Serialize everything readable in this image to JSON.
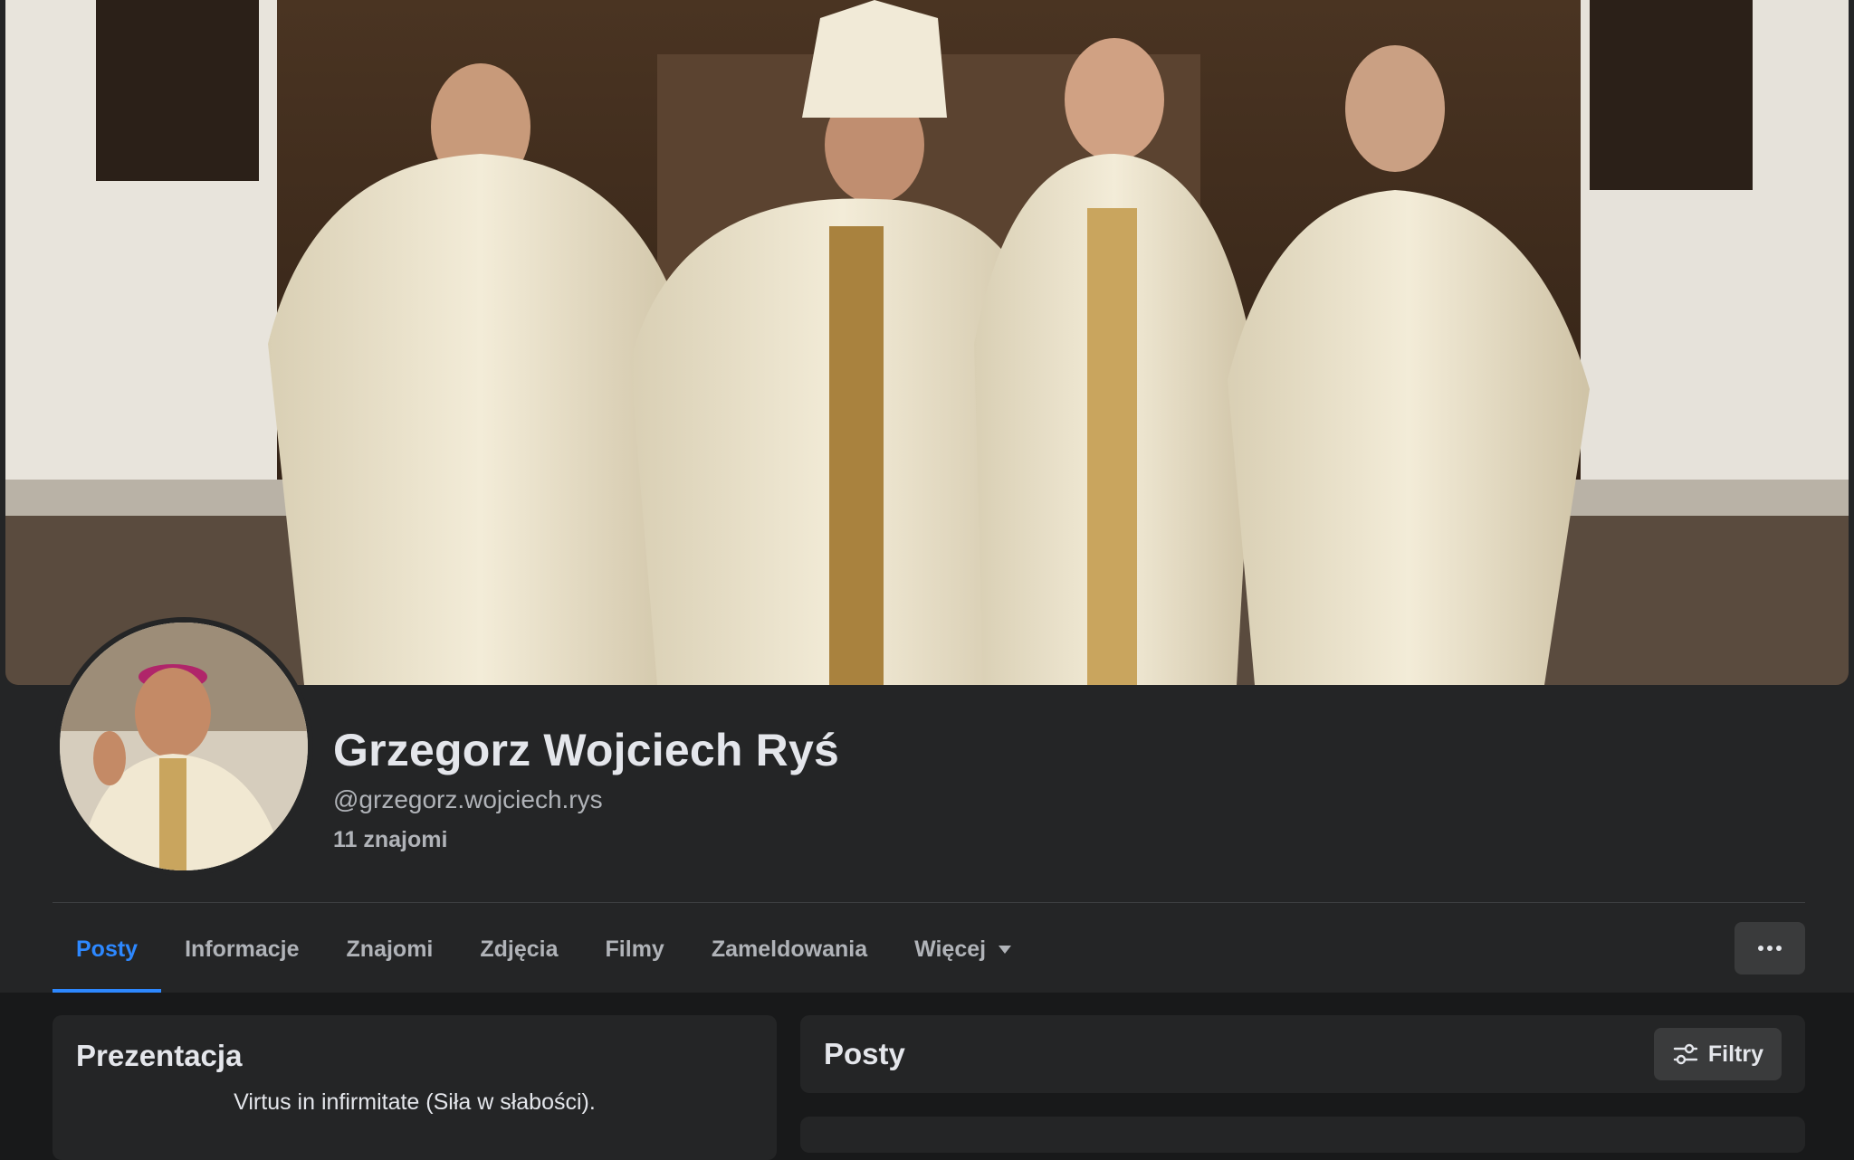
{
  "profile": {
    "name": "Grzegorz Wojciech Ryś",
    "handle": "@grzegorz.wojciech.rys",
    "friends": "11 znajomi"
  },
  "tabs": [
    {
      "label": "Posty",
      "active": true
    },
    {
      "label": "Informacje"
    },
    {
      "label": "Znajomi"
    },
    {
      "label": "Zdjęcia"
    },
    {
      "label": "Filmy"
    },
    {
      "label": "Zameldowania"
    },
    {
      "label": "Więcej"
    }
  ],
  "intro": {
    "title": "Prezentacja",
    "bio": "Virtus in infirmitate (Siła w słabości)."
  },
  "posts": {
    "title": "Posty",
    "filter_label": "Filtry"
  },
  "icons": {
    "more": "ellipsis-icon",
    "filter": "sliders-icon",
    "caret": "caret-down-icon"
  },
  "colors": {
    "accent": "#2d88ff",
    "surface": "#242526",
    "background": "#18191a",
    "button": "#3a3b3c"
  }
}
